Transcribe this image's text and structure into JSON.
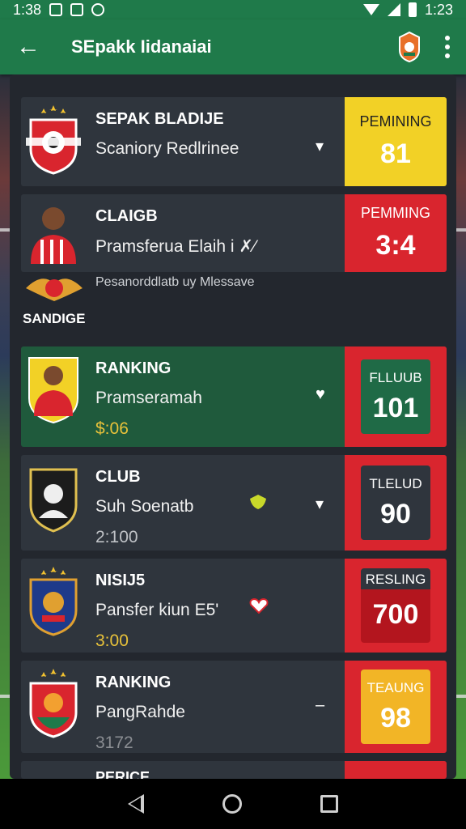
{
  "status_bar": {
    "time_left": "1:38",
    "time_right": "1:23"
  },
  "app_bar": {
    "title": "SEpakk Iidanaiai"
  },
  "rows": [
    {
      "name": "SEPAK BLADIJE",
      "sub": "Scaniory Redlrinee",
      "control": "▾",
      "score_label": "PEMINING",
      "score": "81",
      "score_style": "yellow"
    },
    {
      "name": "CLAIGB",
      "sub": "Pramsferua Elaih i ✗⁄",
      "score_label": "PEMMING",
      "score": "3:4",
      "score_style": "red"
    },
    {
      "name": "RANKING",
      "sub": "Pramseramah",
      "value": "$:06",
      "control": "♥",
      "score_label": "FLLUUB",
      "score": "101",
      "score_style": "green-box"
    },
    {
      "name": "CLUB",
      "sub": "Suh Soenatb",
      "value": "2:100",
      "control": "▾",
      "score_label": "TLELUD",
      "score": "90",
      "score_style": "dark-box"
    },
    {
      "name": "NISIJ5",
      "sub": "Pansfer kiun E5'",
      "value": "3:00",
      "score_label": "RESLING",
      "score": "700",
      "score_style": "crimson-box"
    },
    {
      "name": "RANKING",
      "sub": "PangRahde",
      "value": "3172",
      "control": "–",
      "score_label": "TEAUNG",
      "score": "98",
      "score_style": "orange-box"
    },
    {
      "name": "PERICE"
    }
  ],
  "mid_strip": {
    "caption": "Pesanorddlatb uy Mlessave",
    "label": "SANDIGE"
  },
  "colors": {
    "brand_green": "#1f7a4a",
    "accent_red": "#d9252e",
    "accent_yellow": "#f2d126"
  }
}
